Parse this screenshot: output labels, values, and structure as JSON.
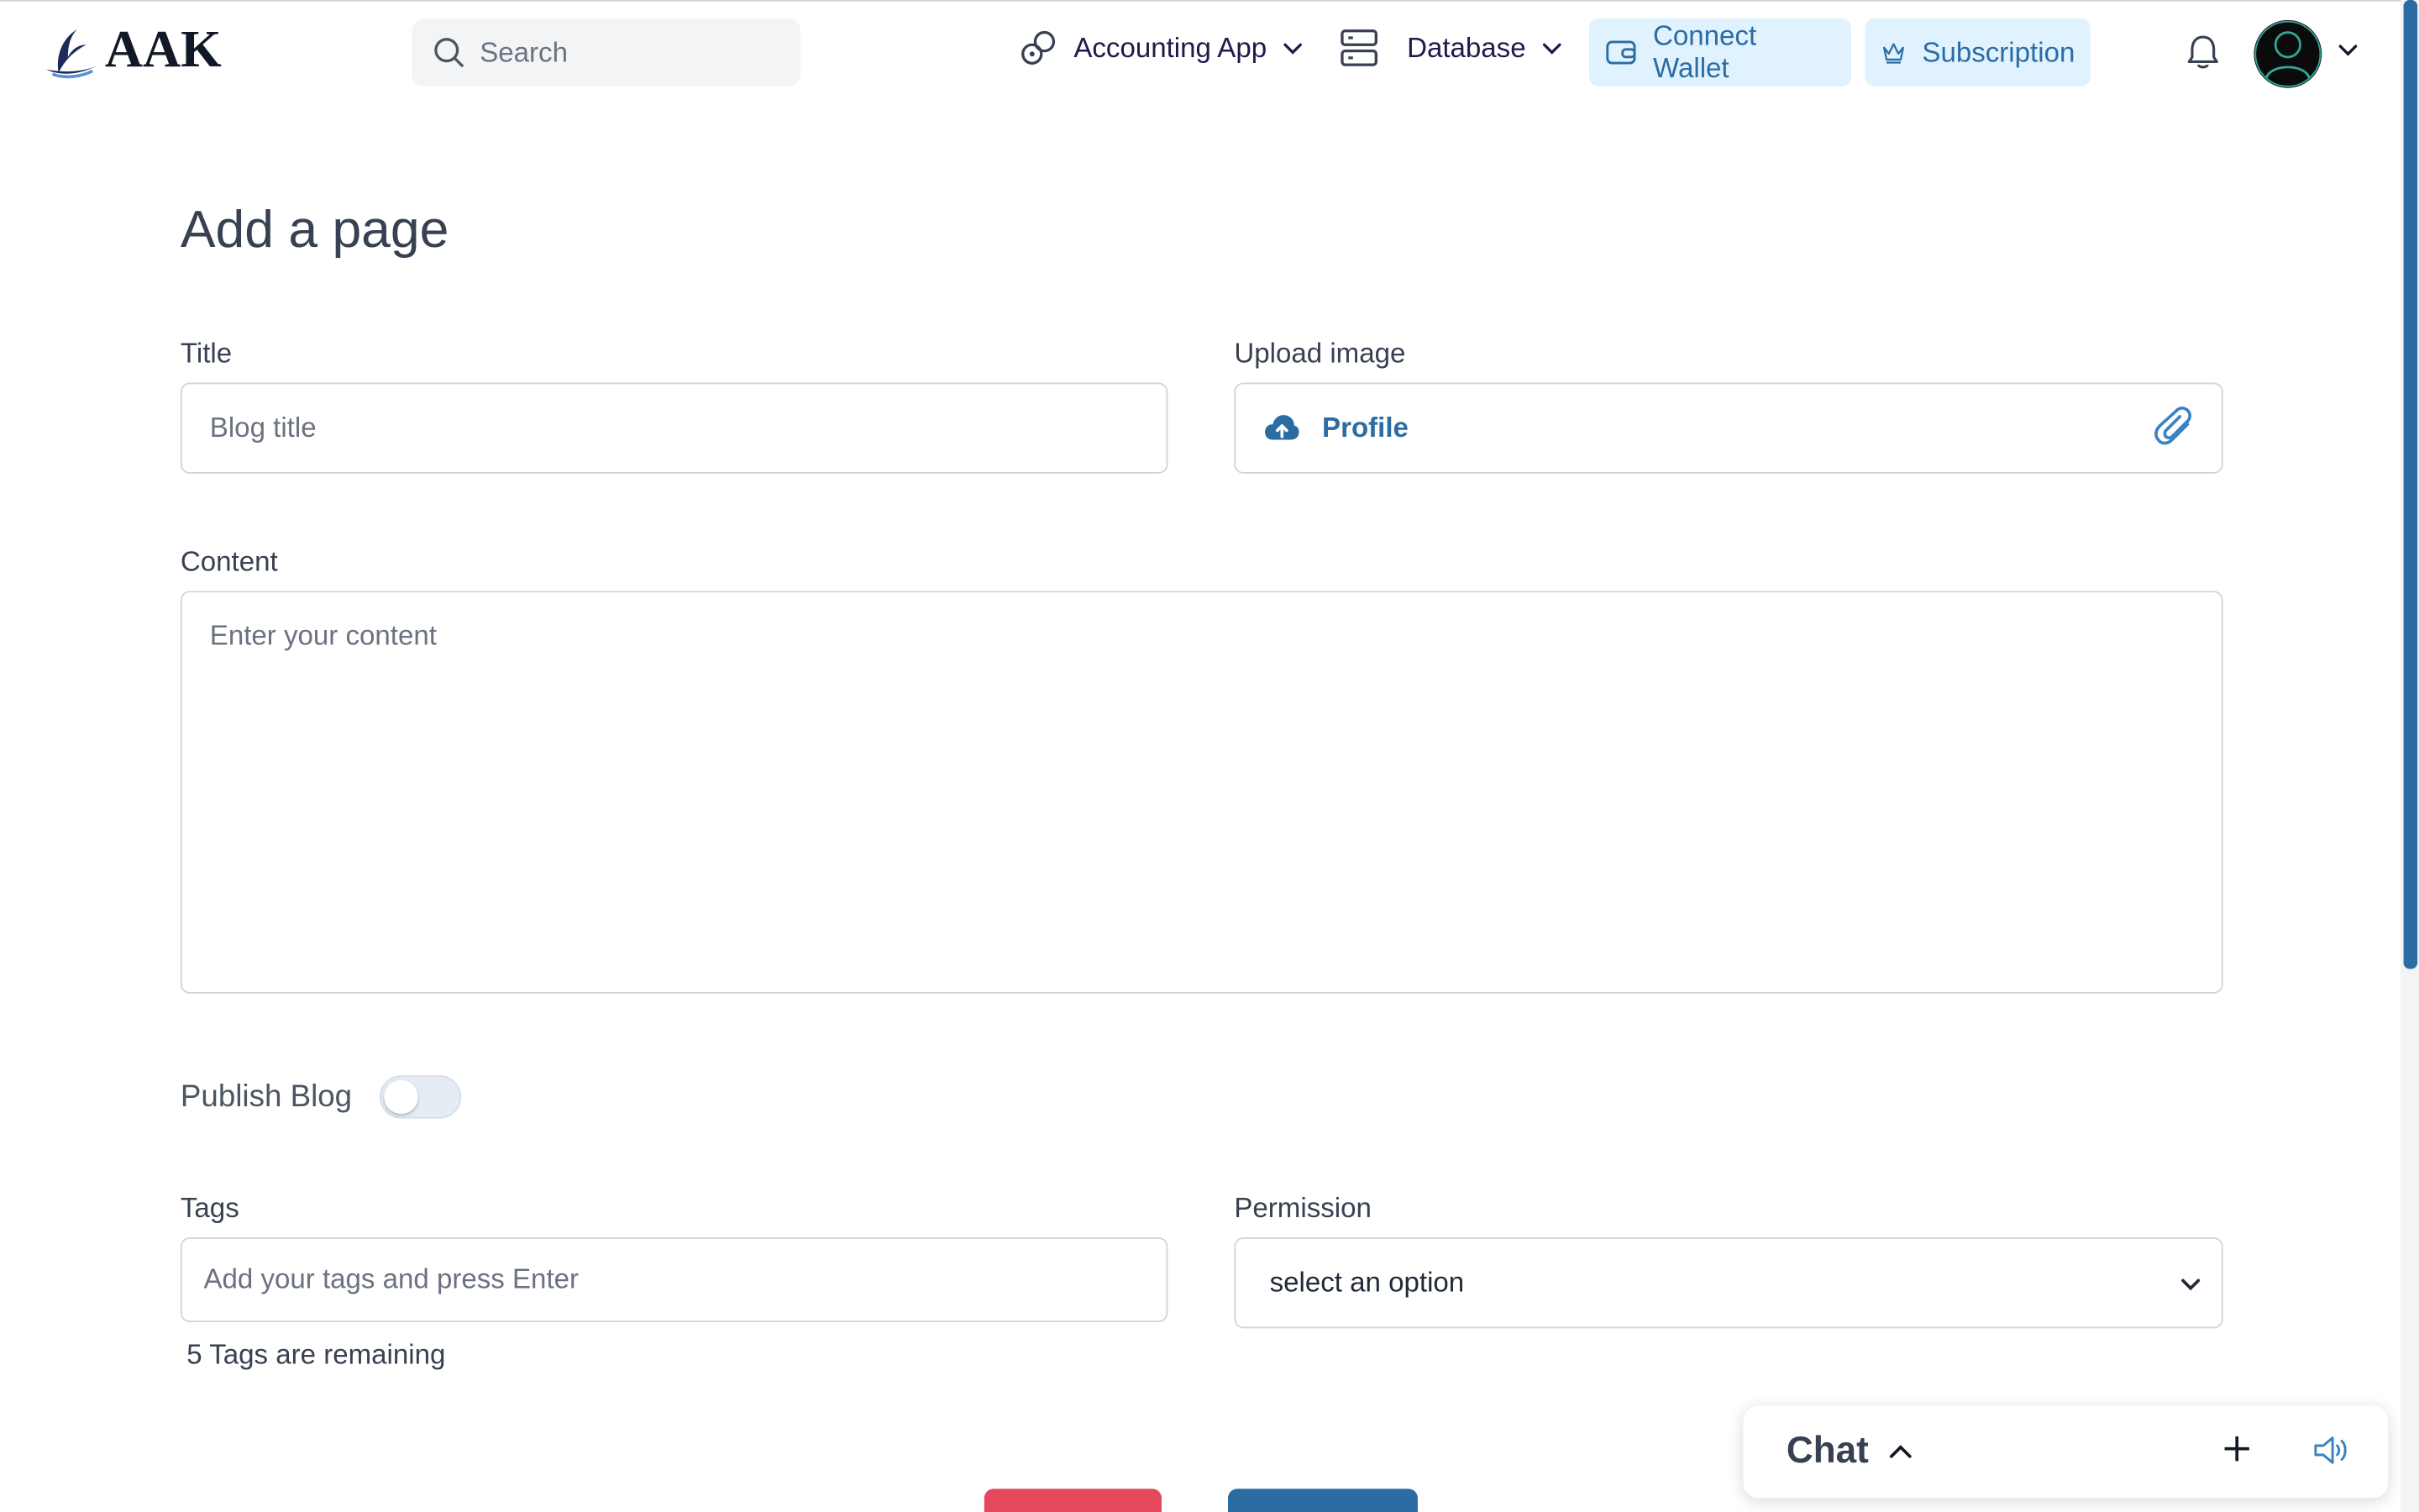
{
  "header": {
    "logo_text": "AAK",
    "search_placeholder": "Search",
    "nav": {
      "accounting_label": "Accounting App",
      "database_label": "Database"
    },
    "connect_wallet_label": "Connect Wallet",
    "subscription_label": "Subscription"
  },
  "page": {
    "title": "Add a page",
    "title_field": {
      "label": "Title",
      "placeholder": "Blog title"
    },
    "upload": {
      "label": "Upload image",
      "button_text": "Profile"
    },
    "content_field": {
      "label": "Content",
      "placeholder": "Enter your content"
    },
    "publish": {
      "label": "Publish Blog",
      "enabled": false
    },
    "tags": {
      "label": "Tags",
      "placeholder": "Add your tags and press Enter",
      "remaining_text": "5 Tags are remaining"
    },
    "permission": {
      "label": "Permission",
      "selected": "select an option"
    }
  },
  "chat": {
    "title": "Chat"
  },
  "colors": {
    "accent": "#2b6ca3",
    "danger": "#e5485d",
    "light_accent_bg": "#e0f2fe"
  }
}
